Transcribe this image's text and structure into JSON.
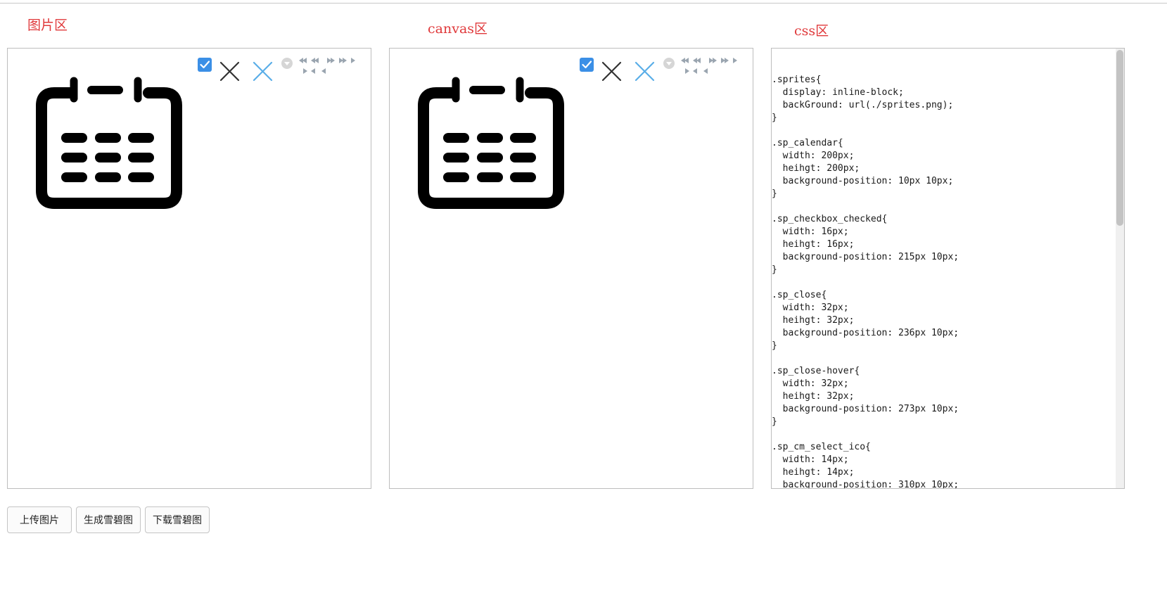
{
  "sections": {
    "image_title": "图片区",
    "canvas_title": "canvas区",
    "css_title": "css区"
  },
  "sprite_icons": [
    "calendar-icon",
    "checkbox-checked-icon",
    "close-icon",
    "close-hover-icon",
    "cm-select-icon",
    "arrow-icons"
  ],
  "css_output": ".sprites{\n  display: inline-block;\n  backGround: url(./sprites.png);\n}\n\n.sp_calendar{\n  width: 200px;\n  heihgt: 200px;\n  background-position: 10px 10px;\n}\n\n.sp_checkbox_checked{\n  width: 16px;\n  heihgt: 16px;\n  background-position: 215px 10px;\n}\n\n.sp_close{\n  width: 32px;\n  heihgt: 32px;\n  background-position: 236px 10px;\n}\n\n.sp_close-hover{\n  width: 32px;\n  heihgt: 32px;\n  background-position: 273px 10px;\n}\n\n.sp_cm_select_ico{\n  width: 14px;\n  heihgt: 14px;\n  background-position: 310px 10px;",
  "buttons": {
    "upload": "上传图片",
    "generate": "生成雪碧图",
    "download": "下载雪碧图"
  },
  "colors": {
    "title_red": "#e0393b",
    "checkbox_blue": "#3b8fe6",
    "close_hover_blue": "#5aaee8",
    "close_dark": "#333333",
    "arrow_gray": "#9aa5b0"
  }
}
